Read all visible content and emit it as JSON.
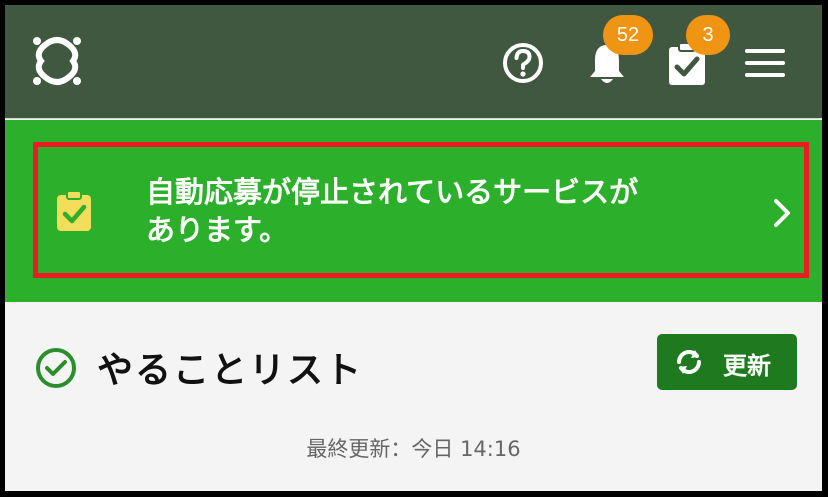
{
  "header": {
    "bg_color": "#405840",
    "logo_icon": "app-logo-icon",
    "help_icon": "question-circle-icon",
    "notifications": {
      "icon": "bell-icon",
      "count": "52"
    },
    "tasks": {
      "icon": "clipboard-check-icon",
      "count": "3"
    },
    "menu_icon": "hamburger-menu-icon",
    "badge_color": "#f09513"
  },
  "alert": {
    "bg_color": "#2caf2a",
    "border_color": "#ec1c24",
    "icon": "clipboard-check-icon",
    "line1": "自動応募が停止されているサービスが",
    "line2": "あります。",
    "chevron": "chevron-right-icon"
  },
  "todo": {
    "icon": "check-circle-icon",
    "title": "やることリスト",
    "refresh_label": "更新",
    "refresh_icon": "refresh-icon",
    "refresh_color": "#1f7a1f",
    "last_updated": "最終更新：今日 14:16"
  }
}
